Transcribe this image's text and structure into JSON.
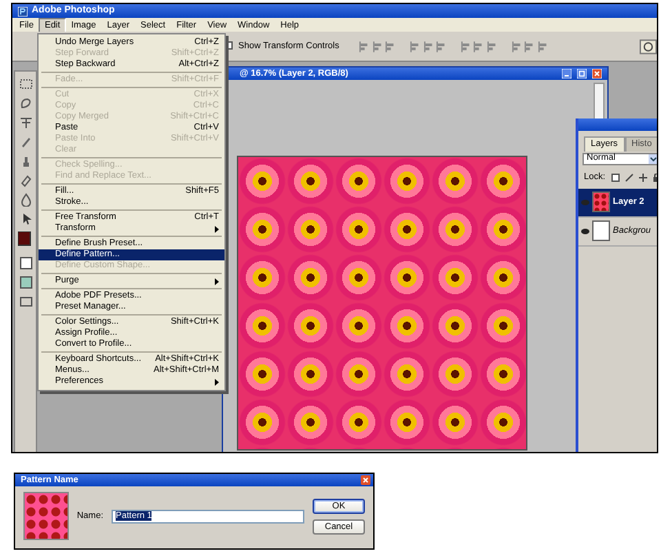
{
  "app": {
    "title": "Adobe Photoshop"
  },
  "menubar": [
    {
      "label": "File",
      "selected": false
    },
    {
      "label": "Edit",
      "selected": true
    },
    {
      "label": "Image",
      "selected": false
    },
    {
      "label": "Layer",
      "selected": false
    },
    {
      "label": "Select",
      "selected": false
    },
    {
      "label": "Filter",
      "selected": false
    },
    {
      "label": "View",
      "selected": false
    },
    {
      "label": "Window",
      "selected": false
    },
    {
      "label": "Help",
      "selected": false
    }
  ],
  "edit_menu": {
    "items": [
      {
        "kind": "item",
        "label": "Undo Merge Layers",
        "shortcut": "Ctrl+Z",
        "disabled": false,
        "selected": false,
        "submenu": false
      },
      {
        "kind": "item",
        "label": "Step Forward",
        "shortcut": "Shift+Ctrl+Z",
        "disabled": true,
        "selected": false,
        "submenu": false
      },
      {
        "kind": "item",
        "label": "Step Backward",
        "shortcut": "Alt+Ctrl+Z",
        "disabled": false,
        "selected": false,
        "submenu": false
      },
      {
        "kind": "separator"
      },
      {
        "kind": "item",
        "label": "Fade...",
        "shortcut": "Shift+Ctrl+F",
        "disabled": true,
        "selected": false,
        "submenu": false
      },
      {
        "kind": "separator"
      },
      {
        "kind": "item",
        "label": "Cut",
        "shortcut": "Ctrl+X",
        "disabled": true,
        "selected": false,
        "submenu": false
      },
      {
        "kind": "item",
        "label": "Copy",
        "shortcut": "Ctrl+C",
        "disabled": true,
        "selected": false,
        "submenu": false
      },
      {
        "kind": "item",
        "label": "Copy Merged",
        "shortcut": "Shift+Ctrl+C",
        "disabled": true,
        "selected": false,
        "submenu": false
      },
      {
        "kind": "item",
        "label": "Paste",
        "shortcut": "Ctrl+V",
        "disabled": false,
        "selected": false,
        "submenu": false
      },
      {
        "kind": "item",
        "label": "Paste Into",
        "shortcut": "Shift+Ctrl+V",
        "disabled": true,
        "selected": false,
        "submenu": false
      },
      {
        "kind": "item",
        "label": "Clear",
        "disabled": true,
        "selected": false,
        "submenu": false
      },
      {
        "kind": "separator"
      },
      {
        "kind": "item",
        "label": "Check Spelling...",
        "disabled": true,
        "selected": false,
        "submenu": false
      },
      {
        "kind": "item",
        "label": "Find and Replace Text...",
        "disabled": true,
        "selected": false,
        "submenu": false
      },
      {
        "kind": "separator"
      },
      {
        "kind": "item",
        "label": "Fill...",
        "shortcut": "Shift+F5",
        "disabled": false,
        "selected": false,
        "submenu": false
      },
      {
        "kind": "item",
        "label": "Stroke...",
        "disabled": false,
        "selected": false,
        "submenu": false
      },
      {
        "kind": "separator"
      },
      {
        "kind": "item",
        "label": "Free Transform",
        "shortcut": "Ctrl+T",
        "disabled": false,
        "selected": false,
        "submenu": false
      },
      {
        "kind": "item",
        "label": "Transform",
        "disabled": false,
        "selected": false,
        "submenu": true
      },
      {
        "kind": "separator"
      },
      {
        "kind": "item",
        "label": "Define Brush Preset...",
        "disabled": false,
        "selected": false,
        "submenu": false
      },
      {
        "kind": "item",
        "label": "Define Pattern...",
        "disabled": false,
        "selected": true,
        "submenu": false
      },
      {
        "kind": "item",
        "label": "Define Custom Shape...",
        "disabled": true,
        "selected": false,
        "submenu": false
      },
      {
        "kind": "separator"
      },
      {
        "kind": "item",
        "label": "Purge",
        "disabled": false,
        "selected": false,
        "submenu": true
      },
      {
        "kind": "separator"
      },
      {
        "kind": "item",
        "label": "Adobe PDF Presets...",
        "disabled": false,
        "selected": false,
        "submenu": false
      },
      {
        "kind": "item",
        "label": "Preset Manager...",
        "disabled": false,
        "selected": false,
        "submenu": false
      },
      {
        "kind": "separator"
      },
      {
        "kind": "item",
        "label": "Color Settings...",
        "shortcut": "Shift+Ctrl+K",
        "disabled": false,
        "selected": false,
        "submenu": false
      },
      {
        "kind": "item",
        "label": "Assign Profile...",
        "disabled": false,
        "selected": false,
        "submenu": false
      },
      {
        "kind": "item",
        "label": "Convert to Profile...",
        "disabled": false,
        "selected": false,
        "submenu": false
      },
      {
        "kind": "separator"
      },
      {
        "kind": "item",
        "label": "Keyboard Shortcuts...",
        "shortcut": "Alt+Shift+Ctrl+K",
        "disabled": false,
        "selected": false,
        "submenu": false
      },
      {
        "kind": "item",
        "label": "Menus...",
        "shortcut": "Alt+Shift+Ctrl+M",
        "disabled": false,
        "selected": false,
        "submenu": false
      },
      {
        "kind": "item",
        "label": "Preferences",
        "disabled": false,
        "selected": false,
        "submenu": true
      }
    ]
  },
  "options_bar": {
    "transform_controls": {
      "label": "Show Transform Controls",
      "checked": false
    }
  },
  "document": {
    "title": "@ 16.7% (Layer 2, RGB/8)"
  },
  "layers_panel": {
    "tabs": [
      {
        "label": "Layers",
        "selected": true
      },
      {
        "label": "Histo",
        "selected": false
      }
    ],
    "blend_mode": "Normal",
    "lock_label": "Lock:",
    "layers": [
      {
        "name": "Layer 2",
        "selected": true,
        "kind": "pattern"
      },
      {
        "name": "Backgrou",
        "selected": false,
        "kind": "blank"
      }
    ]
  },
  "dialog": {
    "title": "Pattern Name",
    "name_label": "Name:",
    "name_value": "Pattern 1",
    "value_selected": true,
    "buttons": [
      {
        "label": "OK",
        "default": true
      },
      {
        "label": "Cancel",
        "default": false
      }
    ]
  }
}
